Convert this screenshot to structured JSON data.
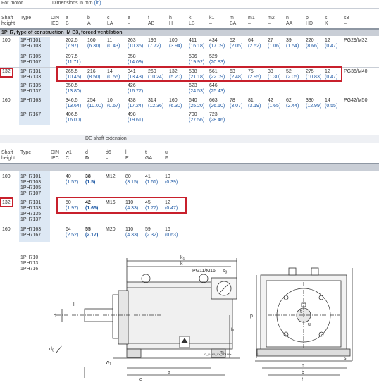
{
  "table1": {
    "header": {
      "for_motor": "For motor",
      "dims": "Dimensions in mm ",
      "dims_unit": "(in)",
      "shaft": "Shaft",
      "height": "height",
      "type": "Type",
      "din": "DIN",
      "iec": "IEC",
      "cols": [
        {
          "top": "a",
          "bot": "B"
        },
        {
          "top": "b",
          "bot": "A"
        },
        {
          "top": "c",
          "bot": "LA"
        },
        {
          "top": "e",
          "bot": "–"
        },
        {
          "top": "f",
          "bot": "AB"
        },
        {
          "top": "h",
          "bot": "H"
        },
        {
          "top": "k",
          "bot": "LB"
        },
        {
          "top": "k1",
          "bot": "–"
        },
        {
          "top": "m",
          "bot": "BA"
        },
        {
          "top": "m1",
          "bot": "–"
        },
        {
          "top": "m2",
          "bot": "–"
        },
        {
          "top": "n",
          "bot": "AA"
        },
        {
          "top": "p",
          "bot": "HD"
        },
        {
          "top": "s",
          "bot": "K"
        },
        {
          "top": "s3",
          "bot": "–"
        }
      ]
    },
    "section_title": "1PH7, type of construction IM B3, forced ventilation",
    "rows": [
      {
        "shaft": "100",
        "types": [
          "1PH7101",
          "1PH7103"
        ],
        "v": [
          "202.5",
          "160",
          "11",
          "263",
          "196",
          "100",
          "411",
          "434",
          "52",
          "64",
          "27",
          "39",
          "220",
          "12",
          "PG29/M32"
        ],
        "i": [
          "(7.97)",
          "(6.30)",
          "(0.43)",
          "(10.35)",
          "(7.72)",
          "(3.94)",
          "(16.18)",
          "(17.09)",
          "(2.05)",
          "(2.52)",
          "(1.06)",
          "(1.54)",
          "(8.66)",
          "(0.47)"
        ]
      },
      {
        "shaft": "",
        "types": [
          "1PH7105",
          "1PH7107"
        ],
        "a": "297.5",
        "ai": "(11.71)",
        "e": "358",
        "ei": "(14.09)",
        "k": "506",
        "ki": "(19.92)",
        "k1": "529",
        "k1i": "(20.83)"
      },
      {
        "shaft": "132",
        "types": [
          "1PH7131",
          "1PH7133"
        ],
        "v": [
          "265.5",
          "216",
          "14",
          "341",
          "260",
          "132",
          "538",
          "561",
          "63",
          "75",
          "33",
          "52",
          "275",
          "12",
          "PG36/M40"
        ],
        "i": [
          "(10.45)",
          "(8.50)",
          "(0.55)",
          "(13.43)",
          "(10.24)",
          "(5.20)",
          "(21.18)",
          "(22.09)",
          "(2.48)",
          "(2.95)",
          "(1.30)",
          "(2.05)",
          "(10.83)",
          "(0.47)"
        ]
      },
      {
        "shaft": "",
        "types": [
          "1PH7135",
          "1PH7137"
        ],
        "a": "350.5",
        "ai": "(13.80)",
        "e": "426",
        "ei": "(16.77)",
        "k": "623",
        "ki": "(24.53)",
        "k1": "646",
        "k1i": "(25.43)"
      },
      {
        "shaft": "160",
        "types": [
          "1PH7163"
        ],
        "v": [
          "346.5",
          "254",
          "10",
          "438",
          "314",
          "160",
          "640",
          "663",
          "78",
          "81",
          "42",
          "62",
          "330",
          "14",
          "PG42/M50"
        ],
        "i": [
          "(13.64)",
          "(10.00)",
          "(0.67)",
          "(17.24)",
          "(12.36)",
          "(6.30)",
          "(25.20)",
          "(26.10)",
          "(3.07)",
          "(3.19)",
          "(1.65)",
          "(2.44)",
          "(12.99)",
          "(0.55)"
        ]
      },
      {
        "shaft": "",
        "types": [
          "1PH7167"
        ],
        "a": "406.5",
        "ai": "(16.00)",
        "e": "498",
        "ei": "(19.61)",
        "k": "700",
        "ki": "(27.56)",
        "k1": "723",
        "k1i": "(28.46)"
      }
    ]
  },
  "table2": {
    "title": "DE shaft extension",
    "shaft": "Shaft",
    "height": "height",
    "type": "Type",
    "din": "DIN",
    "iec": "IEC",
    "cols": [
      {
        "top": "w1",
        "bot": "C"
      },
      {
        "top": "d",
        "bot": "D"
      },
      {
        "top": "d6",
        "bot": "–"
      },
      {
        "top": "l",
        "bot": "E"
      },
      {
        "top": "t",
        "bot": "GA"
      },
      {
        "top": "u",
        "bot": "F"
      }
    ],
    "rows": [
      {
        "shaft": "100",
        "types": [
          "1PH7101",
          "1PH7103",
          "1PH7105",
          "1PH7107"
        ],
        "v": [
          "40",
          "38",
          "M12",
          "80",
          "41",
          "10"
        ],
        "i": [
          "(1.57)",
          "(1.5)",
          "",
          "(3.15)",
          "(1.61)",
          "(0.39)"
        ]
      },
      {
        "shaft": "132",
        "types": [
          "1PH7131",
          "1PH7133",
          "1PH7135",
          "1PH7137"
        ],
        "v": [
          "50",
          "42",
          "M16",
          "110",
          "45",
          "12"
        ],
        "i": [
          "(1.97)",
          "(1.65)",
          "",
          "(4.33)",
          "(1.77)",
          "(0.47)"
        ]
      },
      {
        "shaft": "160",
        "types": [
          "1PH7163",
          "1PH7167"
        ],
        "v": [
          "64",
          "55",
          "M20",
          "110",
          "59",
          "16"
        ],
        "i": [
          "(2.52)",
          "(2.17)",
          "",
          "(4.33)",
          "(2.32)",
          "(0.63)"
        ]
      }
    ]
  },
  "drawing": {
    "models": [
      "1PH710",
      "1PH713",
      "1PH716"
    ],
    "labels": {
      "k1": "k1",
      "k": "k",
      "pg": "PG11/M16",
      "s3": "s3",
      "p": "p",
      "h": "h",
      "l": "l",
      "d": "d",
      "d6": "d6",
      "w1": "w1",
      "m": "m",
      "m1": "m1",
      "m2": "m2",
      "a": "a",
      "e": "e",
      "n": "n",
      "b": "b",
      "f": "f",
      "t": "t",
      "u": "u",
      "s": "s",
      "c": "c",
      "code": "G_DA65_XX_00186a"
    }
  }
}
